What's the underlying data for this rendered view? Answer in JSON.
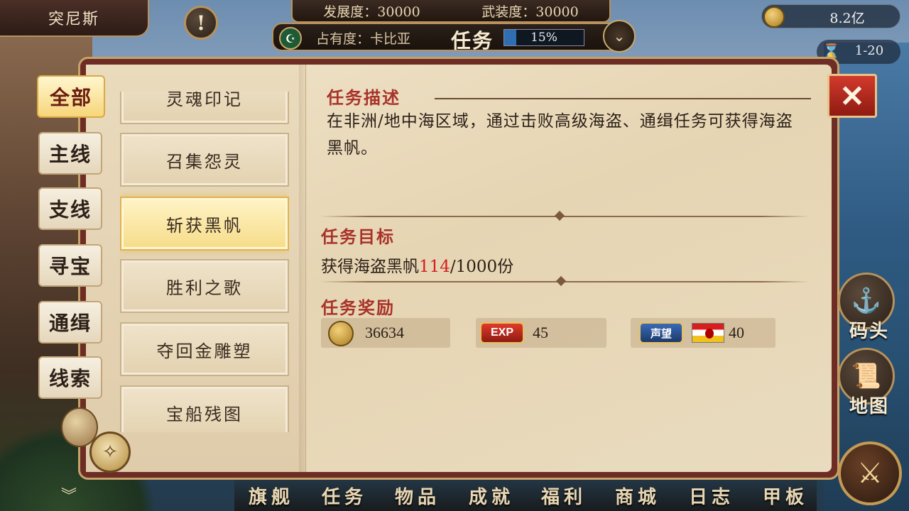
{
  "header": {
    "city": "突尼斯",
    "alert_icon": "!",
    "development": "发展度：30000",
    "armament": "武装度：30000",
    "occupancy": "占有度：卡比亚",
    "mission_title": "任务",
    "progress_text": "15%",
    "progress_value": 0.15
  },
  "resources": {
    "gold": "8.2亿",
    "level_range": "1-20"
  },
  "tabs": [
    {
      "label": "全部",
      "active": true
    },
    {
      "label": "主线",
      "active": false
    },
    {
      "label": "支线",
      "active": false
    },
    {
      "label": "寻宝",
      "active": false
    },
    {
      "label": "通缉",
      "active": false
    },
    {
      "label": "线索",
      "active": false
    }
  ],
  "quests": [
    {
      "label": "灵魂印记",
      "active": false
    },
    {
      "label": "召集怨灵",
      "active": false
    },
    {
      "label": "斩获黑帆",
      "active": true
    },
    {
      "label": "胜利之歌",
      "active": false
    },
    {
      "label": "夺回金雕塑",
      "active": false
    },
    {
      "label": "宝船残图",
      "active": false
    }
  ],
  "detail": {
    "desc_title": "任务描述",
    "desc_text": "在非洲/地中海区域，通过击败高级海盗、通缉任务可获得海盗黑帆。",
    "goal_title": "任务目标",
    "goal_prefix": "获得海盗黑帆",
    "goal_current": "114",
    "goal_suffix": "/1000份",
    "reward_title": "任务奖励",
    "rewards": {
      "gold": "36634",
      "exp_label": "EXP",
      "exp": "45",
      "reputation_label": "声望",
      "reputation": "40"
    }
  },
  "side_buttons": {
    "dock": "码头",
    "map": "地图"
  },
  "bottom_nav": [
    "旗舰",
    "任务",
    "物品",
    "成就",
    "福利",
    "商城",
    "日志",
    "甲板"
  ],
  "colors": {
    "accent_red": "#a8332a",
    "highlight_red": "#d41d1d",
    "panel_border": "#c6a36a"
  }
}
